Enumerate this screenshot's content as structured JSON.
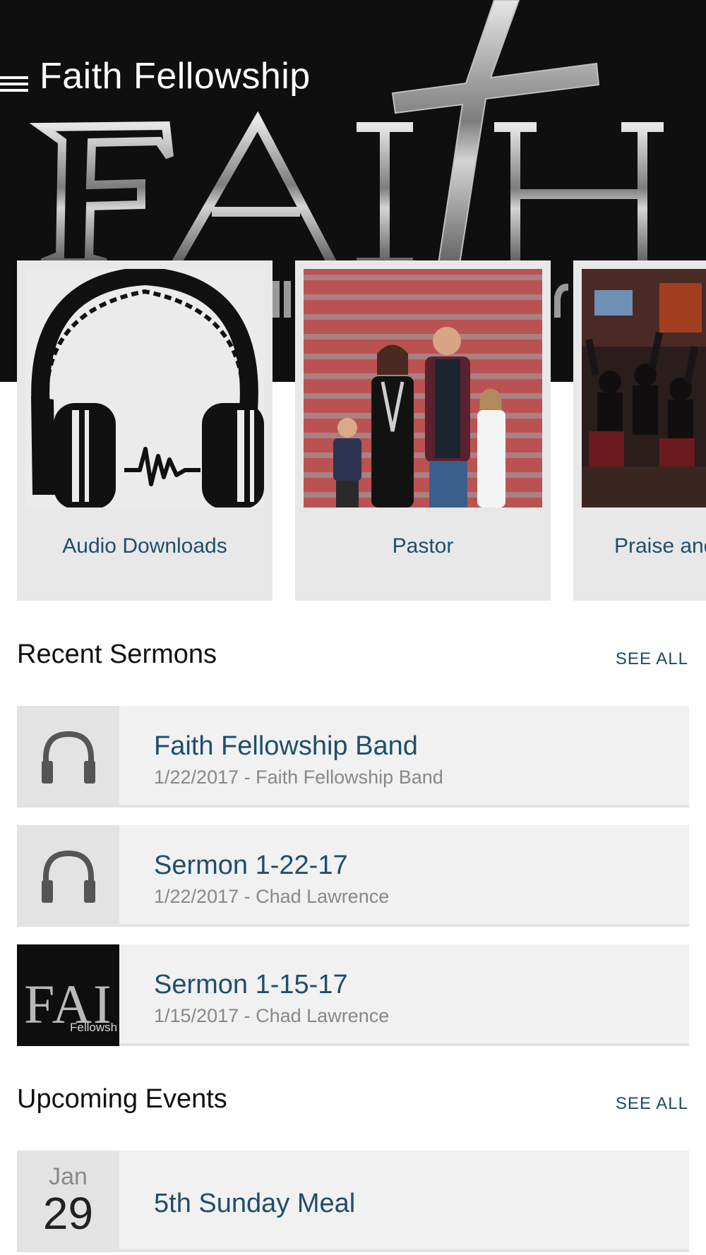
{
  "header": {
    "title": "Faith Fellowship",
    "banner_text": "FAITH",
    "banner_bg": "#0f0f10"
  },
  "carousel": {
    "cards": [
      {
        "label": "Audio Downloads",
        "image": "headphones-soundwave"
      },
      {
        "label": "Pastor",
        "image": "pastor-family-photo"
      },
      {
        "label": "Praise and",
        "image": "worship-service-photo"
      }
    ]
  },
  "sermons": {
    "heading": "Recent Sermons",
    "see_all": "SEE ALL",
    "items": [
      {
        "title": "Faith Fellowship Band",
        "subtitle": "1/22/2017 - Faith Fellowship Band",
        "icon": "headphones-icon"
      },
      {
        "title": "Sermon 1-22-17",
        "subtitle": "1/22/2017 - Chad Lawrence",
        "icon": "headphones-icon"
      },
      {
        "title": "Sermon 1-15-17",
        "subtitle": "1/15/2017 - Chad Lawrence",
        "icon": "faith-logo",
        "thumb_text": "FAI",
        "thumb_sub": "Fellowsh"
      }
    ]
  },
  "events": {
    "heading": "Upcoming Events",
    "see_all": "SEE ALL",
    "items": [
      {
        "month": "Jan",
        "day": "29",
        "title": "5th Sunday Meal"
      }
    ]
  },
  "colors": {
    "link": "#1f4e6b",
    "card_bg": "#e8e8e8",
    "row_bg": "#f1f1f1"
  }
}
